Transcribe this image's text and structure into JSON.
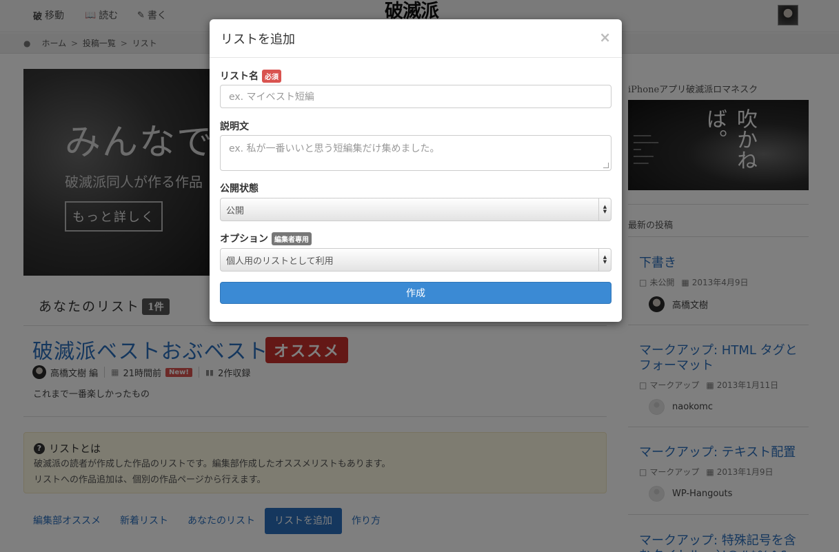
{
  "nav": {
    "move_icon": "破",
    "move_label": "移動",
    "read_label": "読む",
    "write_label": "書く",
    "brand": "破滅派"
  },
  "breadcrumb": {
    "home": "ホーム",
    "sep": ">",
    "posts": "投稿一覧",
    "current": "リスト"
  },
  "hero": {
    "title": "みんなで",
    "subtitle": "破滅派同人が作る作品",
    "button": "もっと詳しく"
  },
  "your_lists": {
    "title": "あなたのリスト",
    "count": "1件",
    "item": {
      "title": "破滅派ベストおぶベスト",
      "badge": "オススメ",
      "author": "高橋文樹 編",
      "time": "21時間前",
      "new_badge": "New!",
      "works": "2作収録",
      "description": "これまで一番楽しかったもの"
    }
  },
  "info": {
    "icon": "?",
    "title": "リストとは",
    "line1": "破滅派の読者が作成した作品のリストです。編集部作成したオススメリストもあります。",
    "line2": "リストへの作品追加は、個別の作品ページから行えます。"
  },
  "tabs": [
    "編集部オススメ",
    "新着リスト",
    "あなたのリスト",
    "リストを追加",
    "作り方"
  ],
  "sidebar": {
    "app_heading": "iPhoneアプリ破滅派ロマネスク",
    "app_image_text": "吹かねば。",
    "latest_heading": "最新の投稿",
    "posts": [
      {
        "title": "下書き",
        "category": "未公開",
        "date": "2013年4月9日",
        "author": "高橋文樹"
      },
      {
        "title": "マークアップ: HTML タグとフォーマット",
        "category": "マークアップ",
        "date": "2013年1月11日",
        "author": "naokomc"
      },
      {
        "title": "マークアップ: テキスト配置",
        "category": "マークアップ",
        "date": "2013年1月9日",
        "author": "WP-Hangouts"
      },
      {
        "title": "マークアップ: 特殊記号を含むタイトル ~`!@#$%^&",
        "category": "",
        "date": "",
        "author": ""
      }
    ]
  },
  "modal": {
    "title": "リストを追加",
    "close": "×",
    "name_label": "リスト名",
    "required_badge": "必須",
    "name_placeholder": "ex. マイベスト短編",
    "desc_label": "説明文",
    "desc_placeholder": "ex. 私が一番いいと思う短編集だけ集めました。",
    "status_label": "公開状態",
    "status_value": "公開",
    "option_label": "オプション",
    "editor_badge": "編集者専用",
    "option_value": "個人用のリストとして利用",
    "submit": "作成"
  }
}
